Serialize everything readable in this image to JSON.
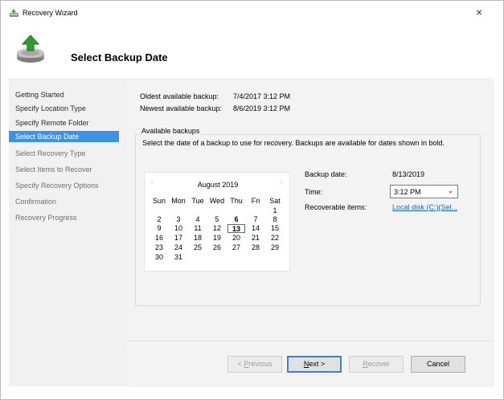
{
  "window": {
    "title": "Recovery Wizard",
    "close": "×"
  },
  "page": {
    "title": "Select Backup Date"
  },
  "sidebar": {
    "items": [
      {
        "label": "Getting Started"
      },
      {
        "label": "Specify Location Type"
      },
      {
        "label": "Specify Remote Folder"
      },
      {
        "label": "Select Backup Date"
      },
      {
        "label": "Select Recovery Type"
      },
      {
        "label": "Select Items to Recover"
      },
      {
        "label": "Specify Recovery Options"
      },
      {
        "label": "Confirmation"
      },
      {
        "label": "Recovery Progress"
      }
    ]
  },
  "info": {
    "oldest_label": "Oldest available backup:",
    "oldest_value": "7/4/2017 3:12 PM",
    "newest_label": "Newest available backup:",
    "newest_value": "8/6/2019 3:12 PM"
  },
  "available": {
    "legend": "Available backups",
    "description": "Select the date of a backup to use for recovery. Backups are available for dates shown in bold."
  },
  "calendar": {
    "prev": "‹",
    "next": "›",
    "month": "August 2019",
    "day_names": [
      "Sun",
      "Mon",
      "Tue",
      "Wed",
      "Thu",
      "Fri",
      "Sat"
    ],
    "weeks": [
      [
        "",
        "",
        "",
        "",
        "",
        "",
        "1"
      ],
      [
        "2",
        "3",
        "4",
        "5",
        "6",
        "7",
        "8"
      ],
      [
        "9",
        "10",
        "11",
        "12",
        "13",
        "14",
        "15"
      ],
      [
        "16",
        "17",
        "18",
        "19",
        "20",
        "21",
        "22"
      ],
      [
        "23",
        "24",
        "25",
        "26",
        "27",
        "28",
        "29"
      ],
      [
        "30",
        "31",
        "",
        "",
        "",
        "",
        ""
      ]
    ],
    "selected": "13",
    "bold": [
      "6",
      "13"
    ]
  },
  "details": {
    "date_label": "Backup date:",
    "date_value": "8/13/2019",
    "time_label": "Time:",
    "time_value": "3:12 PM",
    "items_label": "Recoverable items:",
    "items_link": "Local disk (C:)(Sel..."
  },
  "buttons": {
    "previous": {
      "pre": "< ",
      "mnemonic": "P",
      "rest": "revious"
    },
    "next": {
      "mnemonic": "N",
      "rest": "ext >"
    },
    "recover": {
      "mnemonic": "R",
      "rest": "ecover"
    },
    "cancel": "Cancel"
  }
}
